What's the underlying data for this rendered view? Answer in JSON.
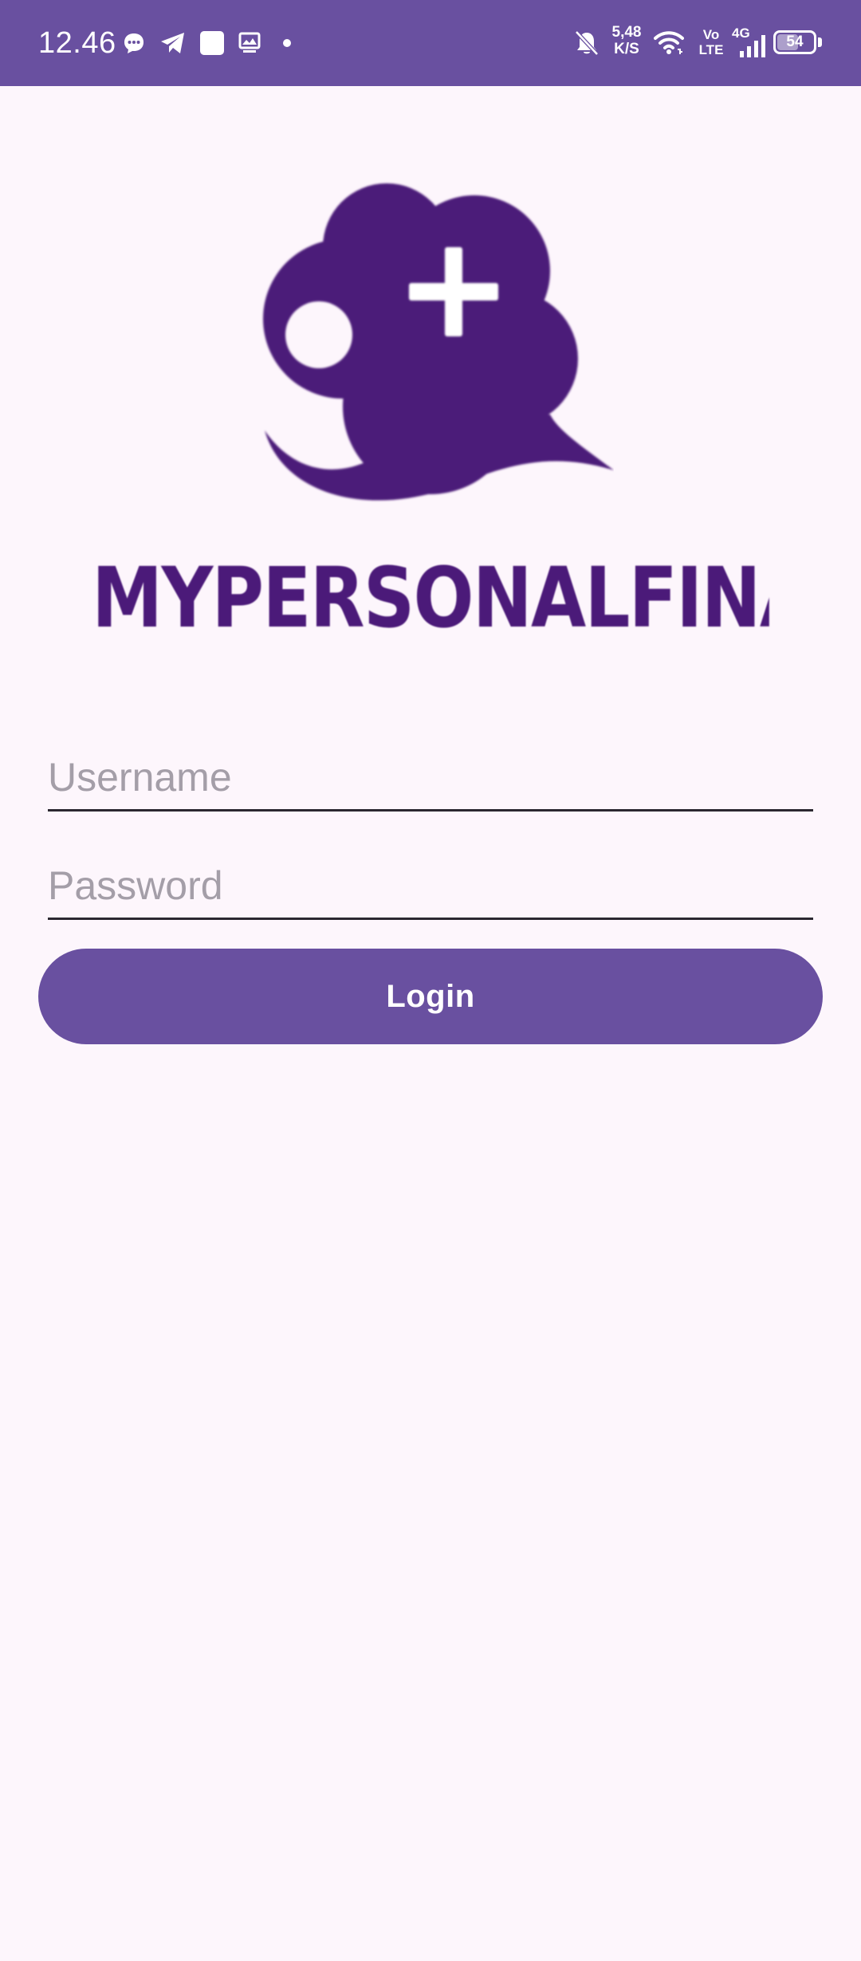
{
  "status_bar": {
    "time": "12.46",
    "net_speed_value": "5,48",
    "net_speed_unit": "K/S",
    "volte_top": "Vo",
    "volte_bottom": "LTE",
    "network_type": "4G",
    "battery": "54",
    "battery_level_percent": 54,
    "icons": [
      "chat-bubble-icon",
      "telegram-icon",
      "square-app-icon",
      "gallery-icon",
      "dot-icon",
      "bell-muted-icon",
      "wifi-icon",
      "signal-bars-icon",
      "battery-icon"
    ]
  },
  "logo": {
    "text": "MYPERSONALFINANCE",
    "color": "#4b1a79"
  },
  "form": {
    "username_placeholder": "Username",
    "username_value": "",
    "password_placeholder": "Password",
    "password_value": "",
    "login_label": "Login"
  },
  "colors": {
    "primary": "#6950a0",
    "background": "#fdf6fc",
    "logo": "#4b1a79"
  }
}
